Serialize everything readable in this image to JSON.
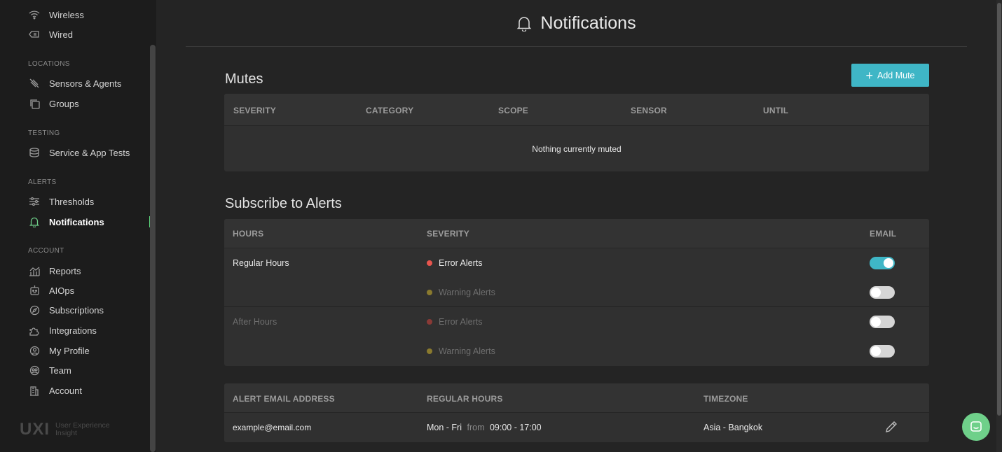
{
  "sidebar": {
    "top_items": [
      {
        "label": "Wireless",
        "icon": "wifi-icon"
      },
      {
        "label": "Wired",
        "icon": "ethernet-icon"
      }
    ],
    "sections": {
      "locations": "LOCATIONS",
      "testing": "TESTING",
      "alerts": "ALERTS",
      "account": "ACCOUNT"
    },
    "locations_items": [
      {
        "label": "Sensors & Agents",
        "icon": "sensor-icon"
      },
      {
        "label": "Groups",
        "icon": "groups-icon"
      }
    ],
    "testing_items": [
      {
        "label": "Service & App Tests",
        "icon": "tests-icon"
      }
    ],
    "alerts_items": [
      {
        "label": "Thresholds",
        "icon": "sliders-icon"
      },
      {
        "label": "Notifications",
        "icon": "bell-icon",
        "active": true
      }
    ],
    "account_items": [
      {
        "label": "Reports",
        "icon": "chart-icon"
      },
      {
        "label": "AIOps",
        "icon": "robot-icon"
      },
      {
        "label": "Subscriptions",
        "icon": "compass-icon"
      },
      {
        "label": "Integrations",
        "icon": "puzzle-icon"
      },
      {
        "label": "My Profile",
        "icon": "user-icon"
      },
      {
        "label": "Team",
        "icon": "team-icon"
      },
      {
        "label": "Account",
        "icon": "building-icon"
      }
    ],
    "brand_logo": "UXI",
    "brand_tagline_1": "User Experience",
    "brand_tagline_2": "Insight"
  },
  "header": {
    "title": "Notifications",
    "icon": "bell-icon"
  },
  "mutes": {
    "title": "Mutes",
    "add_button": "Add Mute",
    "columns": [
      "SEVERITY",
      "CATEGORY",
      "SCOPE",
      "SENSOR",
      "UNTIL"
    ],
    "empty_message": "Nothing currently muted"
  },
  "subscribe": {
    "title": "Subscribe to Alerts",
    "columns": {
      "hours": "HOURS",
      "severity": "SEVERITY",
      "email": "EMAIL"
    },
    "rows": [
      {
        "hours": "Regular Hours",
        "severity": "Error Alerts",
        "email_on": true
      },
      {
        "hours": "",
        "severity": "Warning Alerts",
        "email_on": false
      },
      {
        "hours": "After Hours",
        "severity": "Error Alerts",
        "email_on": false
      },
      {
        "hours": "",
        "severity": "Warning Alerts",
        "email_on": false
      }
    ],
    "colors": {
      "error": "#e8554e",
      "warning": "#c9a227",
      "toggle_on": "#3fb6c6"
    }
  },
  "email_table": {
    "columns": {
      "address": "ALERT EMAIL ADDRESS",
      "hours": "REGULAR HOURS",
      "timezone": "TIMEZONE"
    },
    "row": {
      "address": "example@email.com",
      "days": "Mon - Fri",
      "from_word": "from",
      "time_range": "09:00 - 17:00",
      "timezone": "Asia - Bangkok"
    }
  }
}
